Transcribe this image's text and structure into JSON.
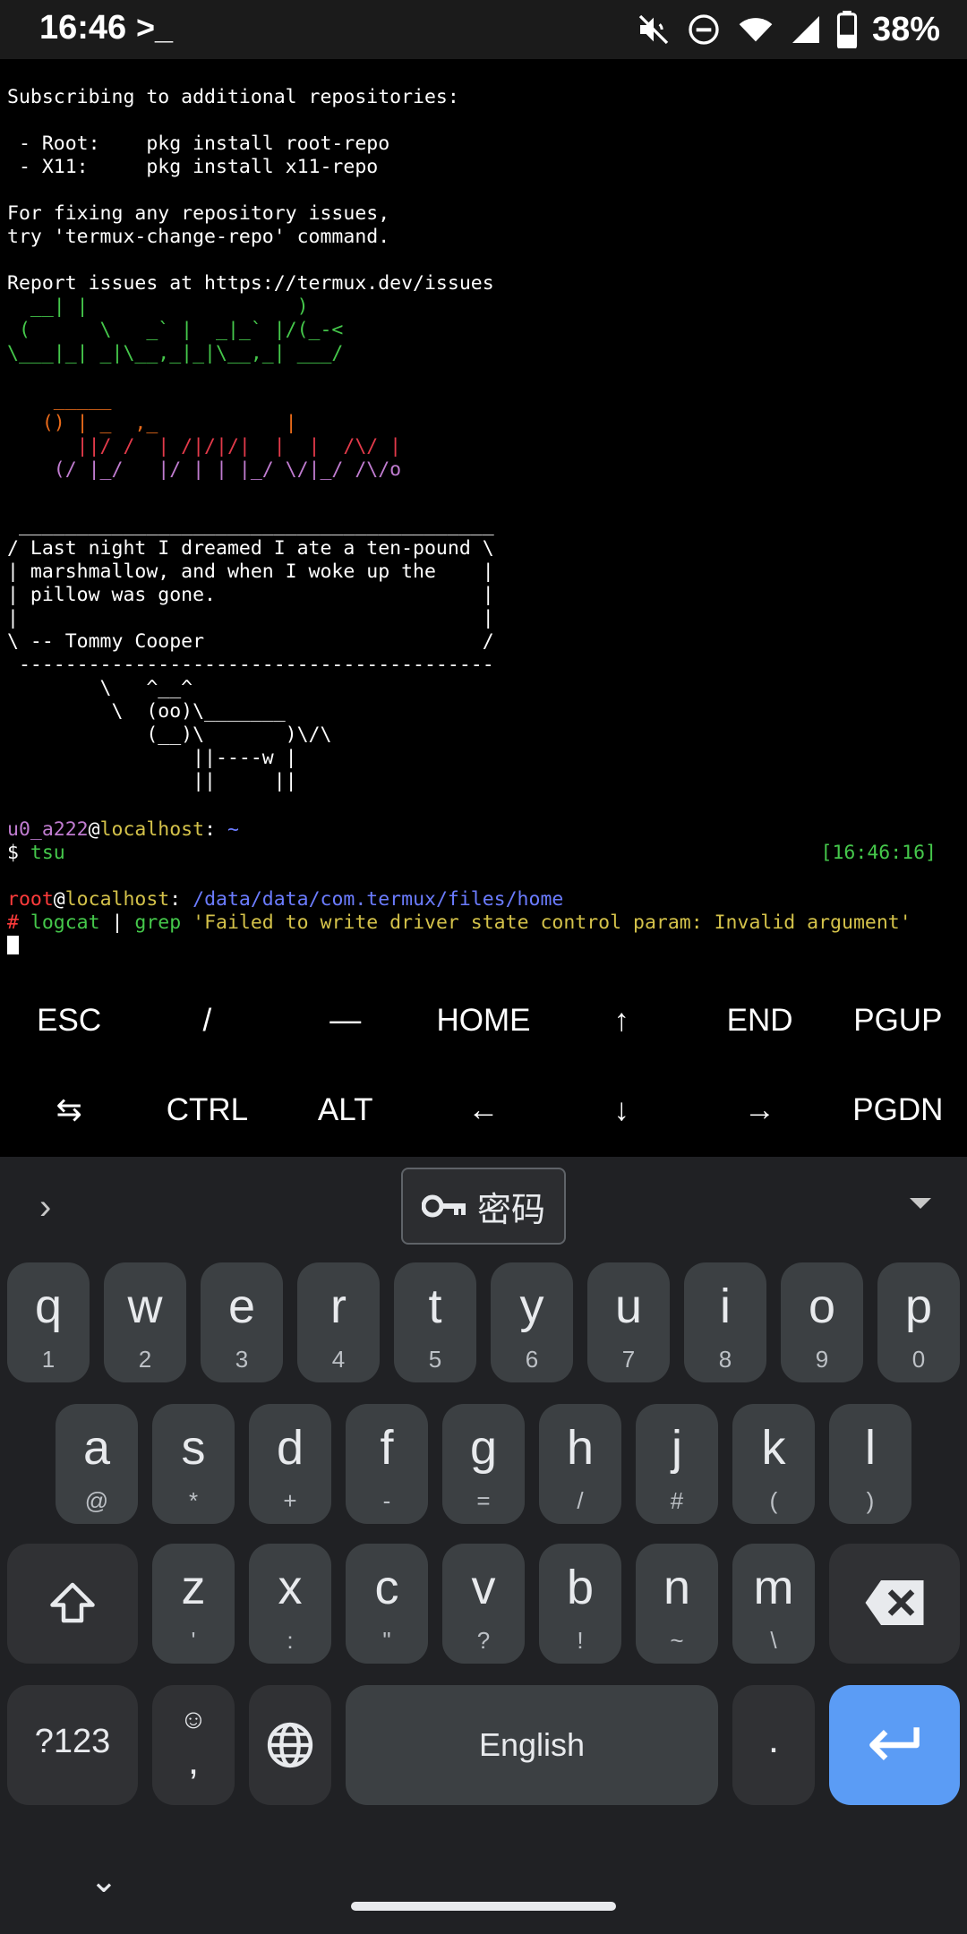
{
  "status_bar": {
    "time": "16:46",
    "terminal_icon": "terminal-prompt-icon",
    "icons": [
      "mute-icon",
      "dnd-icon",
      "wifi-icon",
      "signal-icon",
      "battery-icon"
    ],
    "battery": "38%"
  },
  "terminal": {
    "lines": [
      "Subscribing to additional repositories:",
      "",
      " - Root:    pkg install root-repo",
      " - X11:     pkg install x11-repo",
      "",
      "For fixing any repository issues,",
      "try 'termux-change-repo' command.",
      "",
      "Report issues at https://termux.dev/issues"
    ],
    "art_green": [
      "  __| |                  )",
      " (      \\   _` |  _|_` |/(_-<",
      "\\___|_| _|\\__,_|_|\\__,_| ___/"
    ],
    "art_colored": [
      "    _____",
      "   () | _  ,_           |",
      "      ||/ /  | /|/|/|  |  |  /\\/ |",
      "    (/ |_/   |/ | | |_/ \\/|_/ /\\/o"
    ],
    "cowsay": [
      " _________________________________________",
      "/ Last night I dreamed I ate a ten-pound \\",
      "| marshmallow, and when I woke up the    |",
      "| pillow was gone.                       |",
      "|                                        |",
      "\\ -- Tommy Cooper                        /",
      " -----------------------------------------",
      "        \\   ^__^",
      "         \\  (oo)\\_______",
      "            (__)\\       )\\/\\",
      "                ||----w |",
      "                ||     ||"
    ],
    "prompt1": {
      "user": "u0_a222",
      "at": "@",
      "host": "localhost",
      "sep": ": ",
      "path": "~"
    },
    "cmd1": {
      "symbol": "$ ",
      "text": "tsu"
    },
    "timestamp": "[16:46:16]",
    "prompt2": {
      "user": "root",
      "at": "@",
      "host": "localhost",
      "sep": ": ",
      "path": "/data/data/com.termux/files/home"
    },
    "cmd2": {
      "symbol": "# ",
      "p1": "logcat",
      "pipe": " | ",
      "p2": "grep",
      "arg": " 'Failed to write driver state control param: Invalid argument'"
    }
  },
  "extra_keys": {
    "row1": [
      "ESC",
      "/",
      "—",
      "HOME",
      "↑",
      "END",
      "PGUP"
    ],
    "row2": [
      "⇆",
      "CTRL",
      "ALT",
      "←",
      "↓",
      "→",
      "PGDN"
    ]
  },
  "keyboard": {
    "suggestion_chip": "密码",
    "row1": [
      {
        "k": "q",
        "s": "1"
      },
      {
        "k": "w",
        "s": "2"
      },
      {
        "k": "e",
        "s": "3"
      },
      {
        "k": "r",
        "s": "4"
      },
      {
        "k": "t",
        "s": "5"
      },
      {
        "k": "y",
        "s": "6"
      },
      {
        "k": "u",
        "s": "7"
      },
      {
        "k": "i",
        "s": "8"
      },
      {
        "k": "o",
        "s": "9"
      },
      {
        "k": "p",
        "s": "0"
      }
    ],
    "row2": [
      {
        "k": "a",
        "s": "@"
      },
      {
        "k": "s",
        "s": "*"
      },
      {
        "k": "d",
        "s": "+"
      },
      {
        "k": "f",
        "s": "-"
      },
      {
        "k": "g",
        "s": "="
      },
      {
        "k": "h",
        "s": "/"
      },
      {
        "k": "j",
        "s": "#"
      },
      {
        "k": "k",
        "s": "("
      },
      {
        "k": "l",
        "s": ")"
      }
    ],
    "row3": [
      {
        "k": "z",
        "s": "'"
      },
      {
        "k": "x",
        "s": ":"
      },
      {
        "k": "c",
        "s": "\""
      },
      {
        "k": "v",
        "s": "?"
      },
      {
        "k": "b",
        "s": "!"
      },
      {
        "k": "n",
        "s": "~"
      },
      {
        "k": "m",
        "s": "\\"
      }
    ],
    "symbols_label": "?123",
    "comma_key": ",",
    "space_label": "English",
    "period_key": "."
  }
}
